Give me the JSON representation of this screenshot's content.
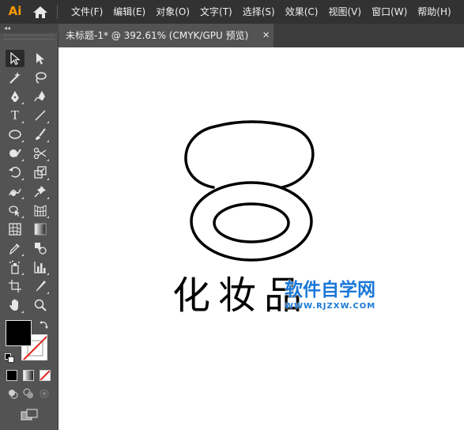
{
  "app": {
    "logo_text": "Ai",
    "accent_color": "#ff9a00"
  },
  "menu": {
    "items": [
      {
        "label": "文件(F)"
      },
      {
        "label": "编辑(E)"
      },
      {
        "label": "对象(O)"
      },
      {
        "label": "文字(T)"
      },
      {
        "label": "选择(S)"
      },
      {
        "label": "效果(C)"
      },
      {
        "label": "视图(V)"
      },
      {
        "label": "窗口(W)"
      },
      {
        "label": "帮助(H)"
      }
    ]
  },
  "panel": {
    "collapse_glyph": "◂◂"
  },
  "tools": [
    {
      "name": "selection-tool",
      "icon": "black-arrow-icon",
      "selected": true
    },
    {
      "name": "direct-selection-tool",
      "icon": "white-arrow-icon"
    },
    {
      "name": "magic-wand-tool",
      "icon": "magic-wand-icon"
    },
    {
      "name": "lasso-tool",
      "icon": "lasso-icon"
    },
    {
      "name": "pen-tool",
      "icon": "pen-icon"
    },
    {
      "name": "curvature-tool",
      "icon": "curvature-icon"
    },
    {
      "name": "type-tool",
      "icon": "type-icon",
      "glyph": "T"
    },
    {
      "name": "line-segment-tool",
      "icon": "line-icon"
    },
    {
      "name": "ellipse-tool",
      "icon": "ellipse-icon"
    },
    {
      "name": "paintbrush-tool",
      "icon": "brush-icon"
    },
    {
      "name": "shaper-tool",
      "icon": "shaper-icon"
    },
    {
      "name": "scissors-tool",
      "icon": "scissors-icon"
    },
    {
      "name": "rotate-tool",
      "icon": "rotate-icon"
    },
    {
      "name": "scale-tool",
      "icon": "scale-icon"
    },
    {
      "name": "warp-tool",
      "icon": "warp-icon"
    },
    {
      "name": "puppet-warp-tool",
      "icon": "pin-icon"
    },
    {
      "name": "shape-builder-tool",
      "icon": "shape-builder-icon"
    },
    {
      "name": "perspective-grid-tool",
      "icon": "perspective-icon"
    },
    {
      "name": "mesh-tool",
      "icon": "mesh-icon"
    },
    {
      "name": "gradient-tool",
      "icon": "gradient-icon"
    },
    {
      "name": "eyedropper-tool",
      "icon": "eyedropper-icon"
    },
    {
      "name": "blend-tool",
      "icon": "blend-icon"
    },
    {
      "name": "symbol-sprayer-tool",
      "icon": "spray-icon"
    },
    {
      "name": "column-graph-tool",
      "icon": "bar-graph-icon"
    },
    {
      "name": "artboard-tool",
      "icon": "artboard-icon"
    },
    {
      "name": "slice-tool",
      "icon": "slice-icon"
    },
    {
      "name": "hand-tool",
      "icon": "hand-icon"
    },
    {
      "name": "zoom-tool",
      "icon": "zoom-icon"
    }
  ],
  "colors": {
    "fill": "#000000",
    "stroke": "none"
  },
  "document": {
    "tab_title": "未标题-1* @ 392.61% (CMYK/GPU 预览)",
    "close_glyph": "✕"
  },
  "artwork": {
    "text": "化妆品"
  },
  "watermark": {
    "main": "软件自学网",
    "url": "WWW.RJZXW.COM",
    "color": "#1a78d8"
  }
}
